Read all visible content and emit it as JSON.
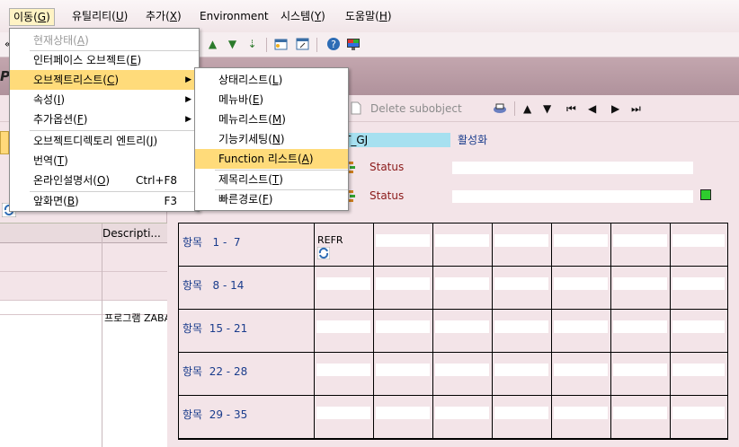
{
  "menubar": {
    "items": [
      {
        "label": "이동(",
        "key": "G",
        "suffix": ")"
      },
      {
        "label": "유틸리티(",
        "key": "U",
        "suffix": ")"
      },
      {
        "label": "추가(",
        "key": "X",
        "suffix": ")"
      },
      {
        "label": "Environment",
        "key": "",
        "suffix": ""
      },
      {
        "label": "시스템(",
        "key": "Y",
        "suffix": ")"
      },
      {
        "label": "도움말(",
        "key": "H",
        "suffix": ")"
      }
    ]
  },
  "toolbar": {
    "back_glyph": "«",
    "help_glyph": "?"
  },
  "titlebar": {
    "title_char": "P"
  },
  "apptoolbar": {
    "delete_subobject": "Delete subobject"
  },
  "left_panel": {
    "column_header": "Descripti...",
    "row_text": "프로그램 ZABA"
  },
  "status_area": {
    "name_value": "T_GJ",
    "active_label": "활성화",
    "status1": "Status",
    "status2": "Status"
  },
  "grid": {
    "rows": [
      {
        "label": "항목   1 -  7"
      },
      {
        "label": "항목   8 - 14"
      },
      {
        "label": "항목  15 - 21"
      },
      {
        "label": "항목  22 - 28"
      },
      {
        "label": "항목  29 - 35"
      }
    ],
    "first_cell": "REFR"
  },
  "menu_goto": {
    "items": [
      {
        "label": "현재상태(",
        "key": "A",
        "suffix": ")",
        "shortcut": "",
        "disabled": true,
        "submenu": false
      },
      {
        "label": "인터페이스 오브젝트(",
        "key": "E",
        "suffix": ")",
        "shortcut": "",
        "disabled": false,
        "submenu": false
      },
      {
        "label": "오브젝트리스트(",
        "key": "C",
        "suffix": ")",
        "shortcut": "",
        "disabled": false,
        "submenu": true
      },
      {
        "label": "속성(",
        "key": "I",
        "suffix": ")",
        "shortcut": "",
        "disabled": false,
        "submenu": true
      },
      {
        "label": "추가옵션(",
        "key": "F",
        "suffix": ")",
        "shortcut": "",
        "disabled": false,
        "submenu": true
      },
      {
        "label": "오브젝트디렉토리 엔트리(",
        "key": "J",
        "suffix": ")",
        "shortcut": "",
        "disabled": false,
        "submenu": false
      },
      {
        "label": "번역(",
        "key": "T",
        "suffix": ")",
        "shortcut": "",
        "disabled": false,
        "submenu": false
      },
      {
        "label": "온라인설명서(",
        "key": "O",
        "suffix": ")",
        "shortcut": "Ctrl+F8",
        "disabled": false,
        "submenu": false
      },
      {
        "label": "앞화면(",
        "key": "B",
        "suffix": ")",
        "shortcut": "F3",
        "disabled": false,
        "submenu": false
      }
    ]
  },
  "menu_objlist": {
    "items": [
      {
        "label": "상태리스트(",
        "key": "L",
        "suffix": ")"
      },
      {
        "label": "메뉴바(",
        "key": "E",
        "suffix": ")"
      },
      {
        "label": "메뉴리스트(",
        "key": "M",
        "suffix": ")"
      },
      {
        "label": "기능키세팅(",
        "key": "N",
        "suffix": ")"
      },
      {
        "label": "Function 리스트(",
        "key": "A",
        "suffix": ")"
      },
      {
        "label": "제목리스트(",
        "key": "T",
        "suffix": ")"
      },
      {
        "label": "빠른경로(",
        "key": "F",
        "suffix": ")"
      }
    ]
  },
  "colors": {
    "highlight": "#ffdb7a",
    "background": "#f3e4e8",
    "name_field": "#a6e0f0",
    "status_green": "#2ecc2e"
  }
}
